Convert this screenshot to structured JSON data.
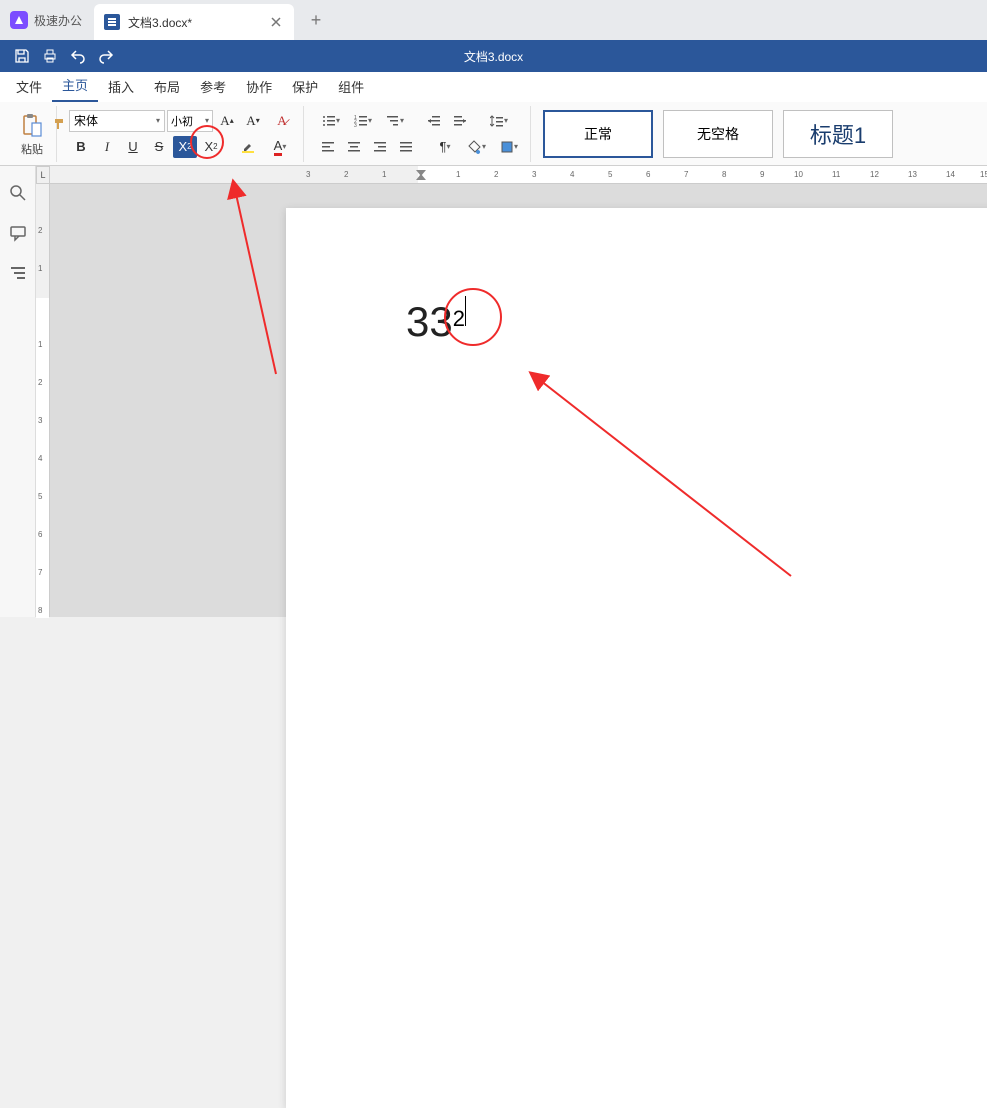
{
  "app": {
    "name": "极速办公"
  },
  "tab": {
    "title": "文档3.docx*"
  },
  "quickbar": {
    "doc_title": "文档3.docx"
  },
  "menu": {
    "file": "文件",
    "home": "主页",
    "insert": "插入",
    "layout": "布局",
    "reference": "参考",
    "collab": "协作",
    "protect": "保护",
    "addin": "组件"
  },
  "ribbon": {
    "paste_label": "粘贴",
    "font_name": "宋体",
    "font_size": "小初",
    "styles": {
      "normal": "正常",
      "nospace": "无空格",
      "heading1": "标题1"
    }
  },
  "document": {
    "base_text": "33",
    "superscript_text": "2"
  },
  "ruler": {
    "h_ticks": [
      "3",
      "2",
      "1",
      "",
      "1",
      "2",
      "3",
      "4",
      "5",
      "6",
      "7",
      "8",
      "9",
      "10",
      "11",
      "12",
      "13",
      "14",
      "15"
    ],
    "v_ticks": [
      "2",
      "1",
      "",
      "1",
      "2",
      "3",
      "4",
      "5",
      "6",
      "7",
      "8"
    ]
  }
}
